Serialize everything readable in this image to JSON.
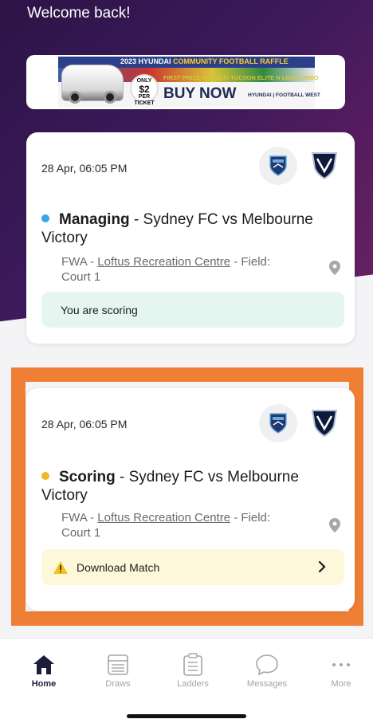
{
  "header": {
    "welcome": "Welcome back!"
  },
  "banner": {
    "title_prefix": "2023 HYUNDAI",
    "title_highlight": "COMMUNITY FOOTBALL RAFFLE",
    "price_only": "ONLY",
    "price": "$2",
    "price_per": "PER",
    "price_ticket": "TICKET",
    "prize_text": "FIRST PRIZE HYUNDAI TUCSON ELITE N LINE TURBO",
    "cta": "BUY NOW",
    "brand": "HYUNDAI | FOOTBALL WEST"
  },
  "cards": [
    {
      "date": "28 Apr, 06:05 PM",
      "role": "Managing",
      "match": " - Sydney FC vs Melbourne Victory",
      "org": "FWA - ",
      "venue": "Loftus Recreation Centre",
      "field": " - Field: Court 1",
      "status": "You are scoring",
      "dot_color": "#3ba3e6"
    },
    {
      "date": "28 Apr, 06:05 PM",
      "role": "Scoring",
      "match": " - Sydney FC vs Melbourne Victory",
      "org": "FWA - ",
      "venue": "Loftus Recreation Centre",
      "field": " - Field: Court 1",
      "status": "Download Match",
      "dot_color": "#f3b61f"
    }
  ],
  "tabs": [
    {
      "label": "Home",
      "icon": "home-icon",
      "active": true
    },
    {
      "label": "Draws",
      "icon": "draws-icon",
      "active": false
    },
    {
      "label": "Ladders",
      "icon": "ladders-icon",
      "active": false
    },
    {
      "label": "Messages",
      "icon": "messages-icon",
      "active": false
    },
    {
      "label": "More",
      "icon": "more-icon",
      "active": false
    }
  ],
  "colors": {
    "highlight_frame": "#ef7f35",
    "scoring_bg": "#e4f6ef",
    "download_bg": "#fdf8d9",
    "accent_dark": "#1e1e3c"
  }
}
